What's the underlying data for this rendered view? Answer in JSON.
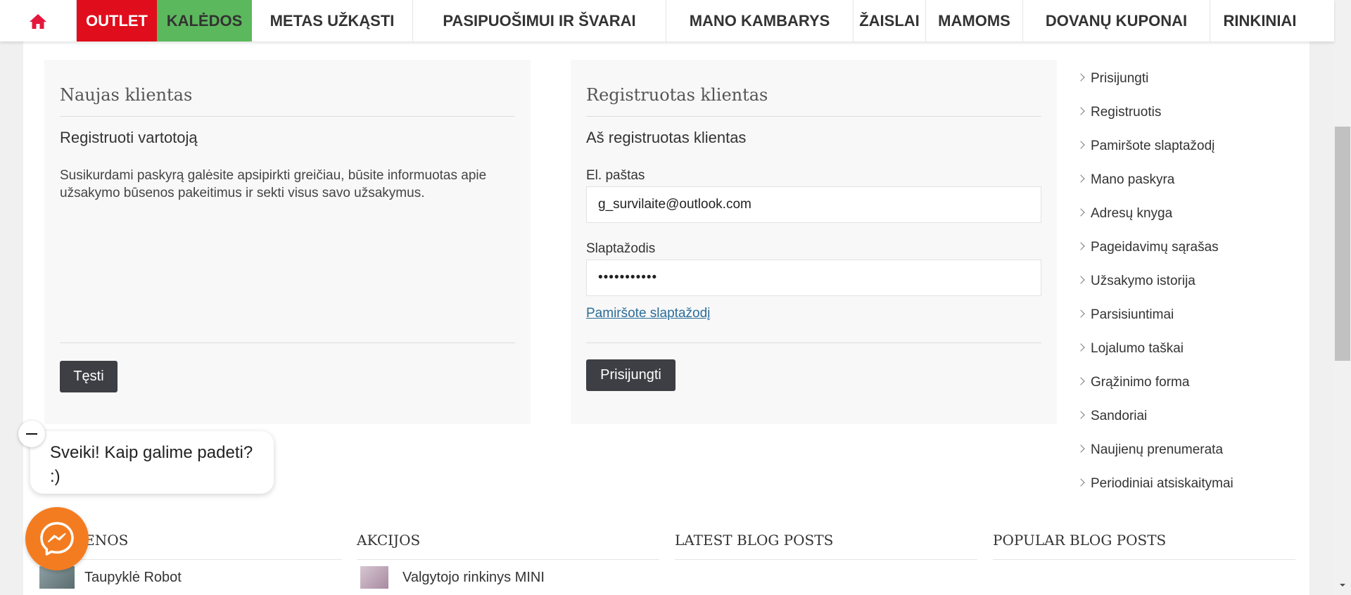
{
  "nav": {
    "home_icon": "home-icon",
    "items": [
      {
        "label": "OUTLET"
      },
      {
        "label": "KALĖDOS"
      },
      {
        "label": "METAS UŽKĄSTI"
      },
      {
        "label": "PASIPUOŠIMUI IR ŠVARAI"
      },
      {
        "label": "MANO KAMBARYS"
      },
      {
        "label": "ŽAISLAI"
      },
      {
        "label": "MAMOMS"
      },
      {
        "label": "DOVANŲ KUPONAI"
      },
      {
        "label": "RINKINIAI"
      }
    ],
    "colors": {
      "outlet_bg": "#e00d1c",
      "kaledos_bg": "#5cb85c",
      "home_icon": "#e4173d"
    }
  },
  "new_customer": {
    "title": "Naujas klientas",
    "subtitle": "Registruoti vartotoją",
    "description": "Susikurdami paskyrą galėsite apsipirkti greičiau, būsite informuotas apie užsakymo būsenos pakeitimus ir sekti visus savo užsakymus.",
    "continue_label": "Tęsti"
  },
  "registered_customer": {
    "title": "Registruotas klientas",
    "subtitle": "Aš registruotas klientas",
    "email_label": "El. paštas",
    "email_value": "g_survilaite@outlook.com",
    "password_label": "Slaptažodis",
    "password_value": "•••••••••••",
    "forgot_label": "Pamiršote slaptažodį",
    "login_label": "Prisijungti"
  },
  "account_nav": [
    {
      "label": "Prisijungti"
    },
    {
      "label": "Registruotis"
    },
    {
      "label": "Pamiršote slaptažodį"
    },
    {
      "label": "Mano paskyra"
    },
    {
      "label": "Adresų knyga"
    },
    {
      "label": "Pageidavimų sąrašas"
    },
    {
      "label": "Užsakymo istorija"
    },
    {
      "label": "Parsisiuntimai"
    },
    {
      "label": "Lojalumo taškai"
    },
    {
      "label": "Grąžinimo forma"
    },
    {
      "label": "Sandoriai"
    },
    {
      "label": "Naujienų prenumerata"
    },
    {
      "label": "Periodiniai atsiskaitymai"
    }
  ],
  "chat": {
    "message": "Sveiki! Kaip galime padeti? :)",
    "messenger_color": "#f47c20"
  },
  "footer": {
    "col1": {
      "title": "NAUJIENOS",
      "item": "Taupyklė Robot"
    },
    "col2": {
      "title": "AKCIJOS",
      "item": "Valgytojo rinkinys MINI"
    },
    "col3": {
      "title": "LATEST BLOG POSTS"
    },
    "col4": {
      "title": "POPULAR BLOG POSTS"
    }
  }
}
